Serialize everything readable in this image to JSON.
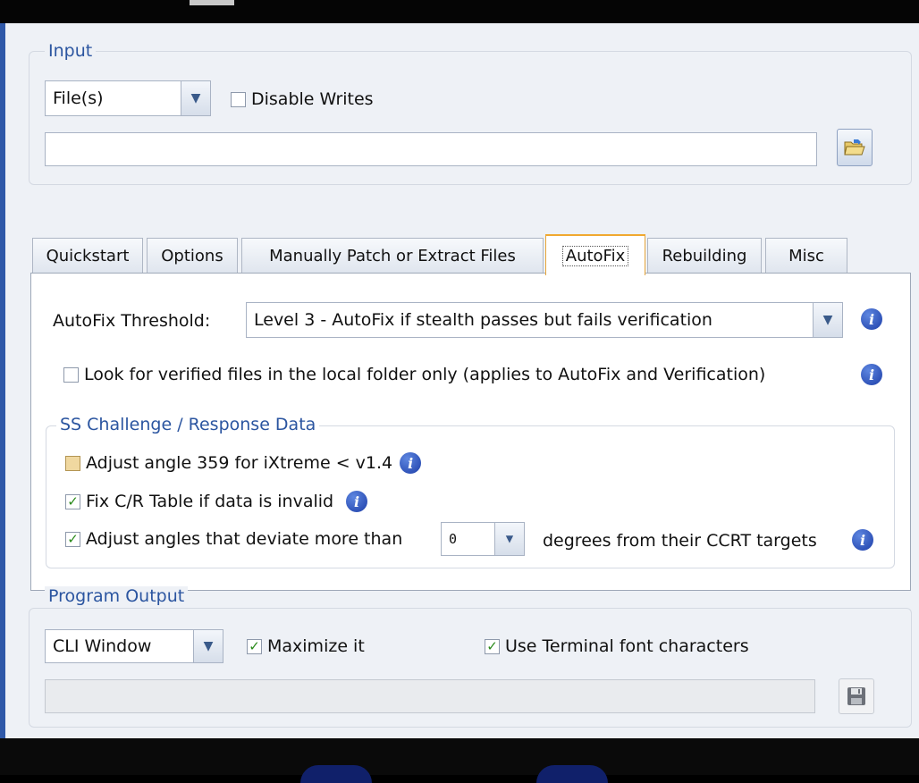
{
  "input": {
    "legend": "Input",
    "source_value": "File(s)",
    "disable_writes_label": "Disable Writes",
    "disable_writes_checked": false,
    "path_value": ""
  },
  "tabs": [
    {
      "label": "Quickstart",
      "active": false
    },
    {
      "label": "Options",
      "active": false
    },
    {
      "label": "Manually Patch or Extract Files",
      "active": false
    },
    {
      "label": "AutoFix",
      "active": true
    },
    {
      "label": "Rebuilding",
      "active": false
    },
    {
      "label": "Misc",
      "active": false
    }
  ],
  "autofix": {
    "threshold_label": "AutoFix Threshold:",
    "threshold_value": "Level 3 - AutoFix if stealth passes but fails verification",
    "local_only_label": "Look for verified files in the local folder only (applies to AutoFix and Verification)",
    "local_only_checked": false,
    "ss_group": {
      "legend": "SS Challenge / Response Data",
      "adjust359_label": "Adjust angle 359 for iXtreme < v1.4",
      "adjust359_state": "indeterminate",
      "fix_cr_label": "Fix C/R Table if data is invalid",
      "fix_cr_checked": true,
      "adjust_angles_label": "Adjust angles that deviate more than",
      "adjust_angles_checked": true,
      "deviation_value": "0",
      "adjust_angles_suffix": "degrees from their CCRT targets"
    }
  },
  "output": {
    "legend": "Program Output",
    "target_value": "CLI Window",
    "maximize_label": "Maximize it",
    "maximize_checked": true,
    "terminal_font_label": "Use Terminal font characters",
    "terminal_font_checked": true,
    "output_path_value": ""
  },
  "icons": {
    "info": "info-icon",
    "folder": "folder-open-icon",
    "save": "save-disk-icon",
    "check_glyph": "✓",
    "dropdown_glyph": "▾",
    "info_glyph": "i"
  }
}
